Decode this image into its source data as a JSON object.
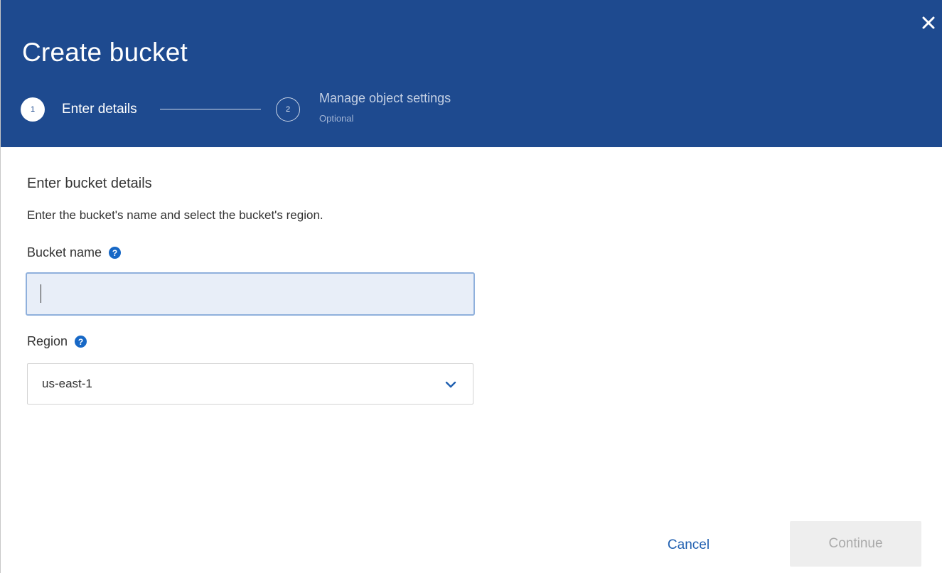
{
  "dialog": {
    "title": "Create bucket",
    "close_icon": "close-icon"
  },
  "stepper": {
    "steps": [
      {
        "number": "1",
        "label": "Enter details",
        "state": "active"
      },
      {
        "number": "2",
        "label": "Manage object settings",
        "sublabel": "Optional",
        "state": "inactive"
      }
    ]
  },
  "form": {
    "section_title": "Enter bucket details",
    "section_description": "Enter the bucket's name and select the bucket's region.",
    "bucket_name": {
      "label": "Bucket name",
      "value": "",
      "help_icon": "help-icon"
    },
    "region": {
      "label": "Region",
      "selected": "us-east-1",
      "help_icon": "help-icon"
    }
  },
  "footer": {
    "cancel_label": "Cancel",
    "continue_label": "Continue"
  },
  "colors": {
    "header_bg": "#1e4a8f",
    "link": "#1f5fb0",
    "help_icon": "#1768c6",
    "input_bg": "#e8eef8",
    "input_border": "#8fb0dc"
  }
}
